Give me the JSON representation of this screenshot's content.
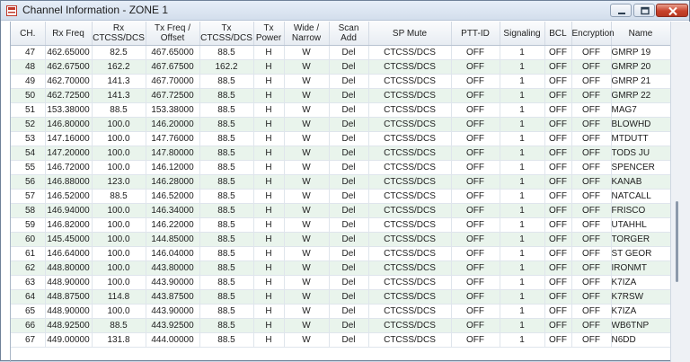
{
  "window": {
    "title": "Channel Information - ZONE 1",
    "icon": "app-icon",
    "buttons": {
      "minimize": "minimize-icon",
      "maximize": "maximize-icon",
      "close": "close-icon"
    }
  },
  "table": {
    "headers": [
      "CH.",
      "Rx Freq",
      "Rx\nCTCSS/DCS",
      "Tx Freq /\nOffset",
      "Tx\nCTCSS/DCS",
      "Tx\nPower",
      "Wide /\nNarrow",
      "Scan\nAdd",
      "SP Mute",
      "PTT-ID",
      "Signaling",
      "BCL",
      "Encryption",
      "Name"
    ],
    "rows": [
      [
        "47",
        "462.65000",
        "82.5",
        "467.65000",
        "88.5",
        "H",
        "W",
        "Del",
        "CTCSS/DCS",
        "OFF",
        "1",
        "OFF",
        "OFF",
        "GMRP 19"
      ],
      [
        "48",
        "462.67500",
        "162.2",
        "467.67500",
        "162.2",
        "H",
        "W",
        "Del",
        "CTCSS/DCS",
        "OFF",
        "1",
        "OFF",
        "OFF",
        "GMRP 20"
      ],
      [
        "49",
        "462.70000",
        "141.3",
        "467.70000",
        "88.5",
        "H",
        "W",
        "Del",
        "CTCSS/DCS",
        "OFF",
        "1",
        "OFF",
        "OFF",
        "GMRP 21"
      ],
      [
        "50",
        "462.72500",
        "141.3",
        "467.72500",
        "88.5",
        "H",
        "W",
        "Del",
        "CTCSS/DCS",
        "OFF",
        "1",
        "OFF",
        "OFF",
        "GMRP 22"
      ],
      [
        "51",
        "153.38000",
        "88.5",
        "153.38000",
        "88.5",
        "H",
        "W",
        "Del",
        "CTCSS/DCS",
        "OFF",
        "1",
        "OFF",
        "OFF",
        "MAG7"
      ],
      [
        "52",
        "146.80000",
        "100.0",
        "146.20000",
        "88.5",
        "H",
        "W",
        "Del",
        "CTCSS/DCS",
        "OFF",
        "1",
        "OFF",
        "OFF",
        "BLOWHD"
      ],
      [
        "53",
        "147.16000",
        "100.0",
        "147.76000",
        "88.5",
        "H",
        "W",
        "Del",
        "CTCSS/DCS",
        "OFF",
        "1",
        "OFF",
        "OFF",
        "MTDUTT"
      ],
      [
        "54",
        "147.20000",
        "100.0",
        "147.80000",
        "88.5",
        "H",
        "W",
        "Del",
        "CTCSS/DCS",
        "OFF",
        "1",
        "OFF",
        "OFF",
        "TODS JU"
      ],
      [
        "55",
        "146.72000",
        "100.0",
        "146.12000",
        "88.5",
        "H",
        "W",
        "Del",
        "CTCSS/DCS",
        "OFF",
        "1",
        "OFF",
        "OFF",
        "SPENCER"
      ],
      [
        "56",
        "146.88000",
        "123.0",
        "146.28000",
        "88.5",
        "H",
        "W",
        "Del",
        "CTCSS/DCS",
        "OFF",
        "1",
        "OFF",
        "OFF",
        "KANAB"
      ],
      [
        "57",
        "146.52000",
        "88.5",
        "146.52000",
        "88.5",
        "H",
        "W",
        "Del",
        "CTCSS/DCS",
        "OFF",
        "1",
        "OFF",
        "OFF",
        "NATCALL"
      ],
      [
        "58",
        "146.94000",
        "100.0",
        "146.34000",
        "88.5",
        "H",
        "W",
        "Del",
        "CTCSS/DCS",
        "OFF",
        "1",
        "OFF",
        "OFF",
        "FRISCO"
      ],
      [
        "59",
        "146.82000",
        "100.0",
        "146.22000",
        "88.5",
        "H",
        "W",
        "Del",
        "CTCSS/DCS",
        "OFF",
        "1",
        "OFF",
        "OFF",
        "UTAHHL"
      ],
      [
        "60",
        "145.45000",
        "100.0",
        "144.85000",
        "88.5",
        "H",
        "W",
        "Del",
        "CTCSS/DCS",
        "OFF",
        "1",
        "OFF",
        "OFF",
        "TORGER"
      ],
      [
        "61",
        "146.64000",
        "100.0",
        "146.04000",
        "88.5",
        "H",
        "W",
        "Del",
        "CTCSS/DCS",
        "OFF",
        "1",
        "OFF",
        "OFF",
        "ST GEOR"
      ],
      [
        "62",
        "448.80000",
        "100.0",
        "443.80000",
        "88.5",
        "H",
        "W",
        "Del",
        "CTCSS/DCS",
        "OFF",
        "1",
        "OFF",
        "OFF",
        "IRONMT"
      ],
      [
        "63",
        "448.90000",
        "100.0",
        "443.90000",
        "88.5",
        "H",
        "W",
        "Del",
        "CTCSS/DCS",
        "OFF",
        "1",
        "OFF",
        "OFF",
        "K7IZA"
      ],
      [
        "64",
        "448.87500",
        "114.8",
        "443.87500",
        "88.5",
        "H",
        "W",
        "Del",
        "CTCSS/DCS",
        "OFF",
        "1",
        "OFF",
        "OFF",
        "K7RSW"
      ],
      [
        "65",
        "448.90000",
        "100.0",
        "443.90000",
        "88.5",
        "H",
        "W",
        "Del",
        "CTCSS/DCS",
        "OFF",
        "1",
        "OFF",
        "OFF",
        "K7IZA"
      ],
      [
        "66",
        "448.92500",
        "88.5",
        "443.92500",
        "88.5",
        "H",
        "W",
        "Del",
        "CTCSS/DCS",
        "OFF",
        "1",
        "OFF",
        "OFF",
        "WB6TNP"
      ],
      [
        "67",
        "449.00000",
        "131.8",
        "444.00000",
        "88.5",
        "H",
        "W",
        "Del",
        "CTCSS/DCS",
        "OFF",
        "1",
        "OFF",
        "OFF",
        "N6DD"
      ]
    ]
  },
  "colors": {
    "row_alt": "#e9f4ec",
    "row": "#ffffff",
    "close_button": "#c8432c"
  }
}
